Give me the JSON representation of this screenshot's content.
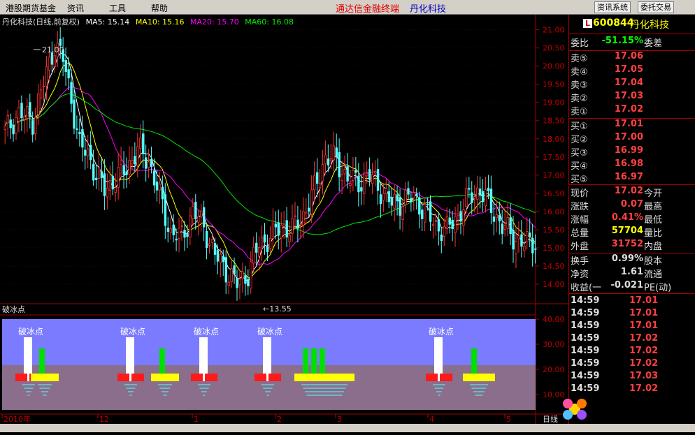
{
  "menu": {
    "items": [
      "港股期货基金",
      "资讯",
      "工具",
      "帮助"
    ],
    "ad": "通达信金融终端",
    "stock_name": "丹化科技",
    "btn_info": "资讯系统",
    "btn_trade": "委托交易"
  },
  "legend": {
    "title": "丹化科技(日线,前复权)",
    "ma5": "MA5: 15.14",
    "ma10": "MA10: 15.16",
    "ma20": "MA20: 15.70",
    "ma60": "MA60: 16.08",
    "high_label": "21.00",
    "low_label": "13.55"
  },
  "indicator": {
    "title": "破冰点",
    "signal_text": "破冰点",
    "yticks": [
      "40.00",
      "30.00",
      "20.00",
      "10.00"
    ]
  },
  "axis": {
    "yticks": [
      "21.00",
      "20.50",
      "20.00",
      "19.50",
      "19.00",
      "18.50",
      "18.00",
      "17.50",
      "17.00",
      "16.50",
      "16.00",
      "15.50",
      "15.00",
      "14.50",
      "14.00"
    ],
    "xlabels": [
      "2010年",
      "12",
      "1",
      "2",
      "3",
      "4",
      "5"
    ],
    "period": "日线"
  },
  "quote": {
    "code": "600844",
    "name": "丹化科技",
    "badge": "L",
    "weibi_label": "委比",
    "weibi": "-51.15%",
    "weicha_label": "委差",
    "asks": [
      {
        "label": "卖⑤",
        "price": "17.06"
      },
      {
        "label": "卖④",
        "price": "17.05"
      },
      {
        "label": "卖③",
        "price": "17.04"
      },
      {
        "label": "卖②",
        "price": "17.03"
      },
      {
        "label": "卖①",
        "price": "17.02"
      }
    ],
    "bids": [
      {
        "label": "买①",
        "price": "17.01"
      },
      {
        "label": "买②",
        "price": "17.00"
      },
      {
        "label": "买③",
        "price": "16.99"
      },
      {
        "label": "买④",
        "price": "16.98"
      },
      {
        "label": "买⑤",
        "price": "16.97"
      }
    ],
    "stats": [
      {
        "label": "现价",
        "value": "17.02",
        "label2": "今开",
        "color": "#ff4040"
      },
      {
        "label": "涨跌",
        "value": "0.07",
        "label2": "最高",
        "color": "#ff4040"
      },
      {
        "label": "涨幅",
        "value": "0.41%",
        "label2": "最低",
        "color": "#ff4040"
      },
      {
        "label": "总量",
        "value": "57704",
        "label2": "量比",
        "color": "#ffff00"
      },
      {
        "label": "外盘",
        "value": "31752",
        "label2": "内盘",
        "color": "#ff4040"
      }
    ],
    "stats2": [
      {
        "label": "换手",
        "value": "0.99%",
        "label2": "股本",
        "color": "#ddd"
      },
      {
        "label": "净资",
        "value": "1.61",
        "label2": "流通",
        "color": "#ddd"
      },
      {
        "label": "收益(一",
        "value": "-0.021",
        "label2": "PE(动)",
        "color": "#ddd"
      }
    ],
    "trades": [
      {
        "time": "14:59",
        "price": "17.01"
      },
      {
        "time": "14:59",
        "price": "17.01"
      },
      {
        "time": "14:59",
        "price": "17.01"
      },
      {
        "time": "14:59",
        "price": "17.02"
      },
      {
        "time": "14:59",
        "price": "17.02"
      },
      {
        "time": "14:59",
        "price": "17.02"
      },
      {
        "time": "14:59",
        "price": "17.03"
      },
      {
        "time": "14:59",
        "price": "17.02"
      }
    ]
  },
  "colors": {
    "up": "#ff3232",
    "down": "#54ffff",
    "ma5": "#ffffff",
    "ma10": "#ffff00",
    "ma20": "#ff00ff",
    "ma60": "#00e600",
    "panel_border": "#a00000"
  },
  "chart_data": {
    "type": "candlestick",
    "ylim": [
      13.5,
      21.3
    ],
    "ma60_last": 16.08
  }
}
